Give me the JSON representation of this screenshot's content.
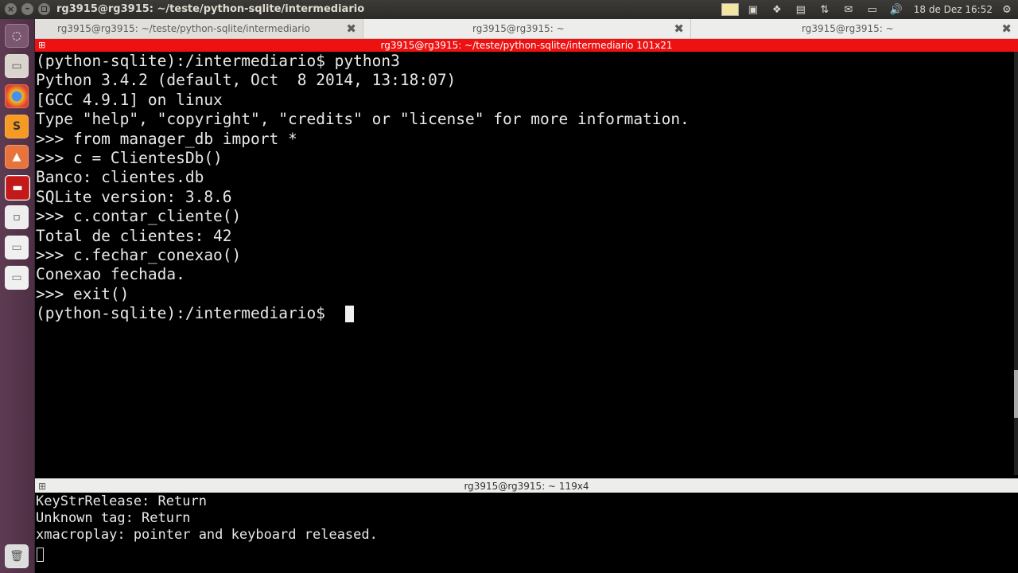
{
  "top_panel": {
    "title": "rg3915@rg3915: ~/teste/python-sqlite/intermediario",
    "clock": "18 de Dez 16:52"
  },
  "tabs": [
    {
      "label": "rg3915@rg3915: ~/teste/python-sqlite/intermediario",
      "close": "✖"
    },
    {
      "label": "rg3915@rg3915: ~",
      "close": "✖"
    },
    {
      "label": "rg3915@rg3915: ~",
      "close": "✖"
    }
  ],
  "terminal_top": {
    "header": "rg3915@rg3915: ~/teste/python-sqlite/intermediario 101x21",
    "lines": [
      "(python-sqlite):/intermediario$ python3",
      "Python 3.4.2 (default, Oct  8 2014, 13:18:07)",
      "[GCC 4.9.1] on linux",
      "Type \"help\", \"copyright\", \"credits\" or \"license\" for more information.",
      ">>> from manager_db import *",
      ">>> c = ClientesDb()",
      "Banco: clientes.db",
      "SQLite version: 3.8.6",
      ">>> c.contar_cliente()",
      "Total de clientes: 42",
      ">>> c.fechar_conexao()",
      "Conexao fechada.",
      ">>> exit()",
      "(python-sqlite):/intermediario$ "
    ]
  },
  "terminal_bottom": {
    "header": "rg3915@rg3915: ~ 119x4",
    "lines": [
      "KeyStrRelease: Return",
      "Unknown tag: Return",
      "xmacroplay: pointer and keyboard released."
    ]
  }
}
